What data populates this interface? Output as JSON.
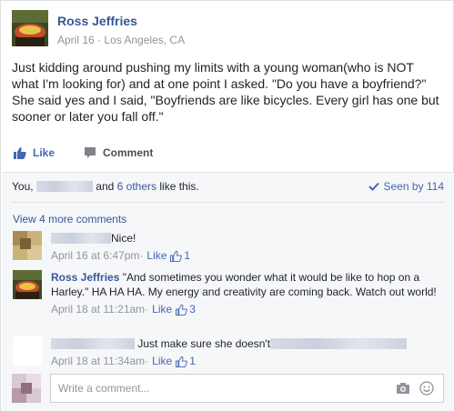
{
  "post": {
    "author": "Ross Jeffries",
    "meta": "April 16 · Los Angeles, CA",
    "text": "Just kidding around pushing my limits with a young woman(who is NOT what I'm looking for) and at one point I asked. \"Do you have a boyfriend?\" She said yes and I said, \"Boyfriends are like bicycles. Every girl has one but sooner or later you fall off.\""
  },
  "actions": {
    "like_label": "Like",
    "comment_label": "Comment",
    "like_icon": "thumbs-up-icon",
    "comment_icon": "speech-bubble-icon"
  },
  "likes": {
    "you": "You,",
    "and": "and",
    "others": "6 others",
    "like_this": "like this.",
    "seen": "Seen by 114"
  },
  "view_more": "View 4 more comments",
  "comments": [
    {
      "name": "",
      "text": "Nice!",
      "time": "April 16 at 6:47pm",
      "like_label": "Like",
      "likes": "1"
    },
    {
      "name": "Ross Jeffries",
      "text": "\"And sometimes you wonder what it would be like to hop on a Harley.\" HA HA HA. My energy and creativity are coming back. Watch out world!",
      "time": "April 18 at 11:21am",
      "like_label": "Like",
      "likes": "3"
    },
    {
      "name": "",
      "text": "Just make sure she doesn't",
      "time": "April 18 at 11:34am",
      "like_label": "Like",
      "likes": "1"
    }
  ],
  "composer": {
    "placeholder": "Write a comment...",
    "camera_icon": "camera-icon",
    "emoji_icon": "emoji-icon"
  },
  "colors": {
    "link": "#365899",
    "accent": "#4267b2",
    "meta": "#90949c",
    "bg_ufi": "#f6f7f9"
  }
}
